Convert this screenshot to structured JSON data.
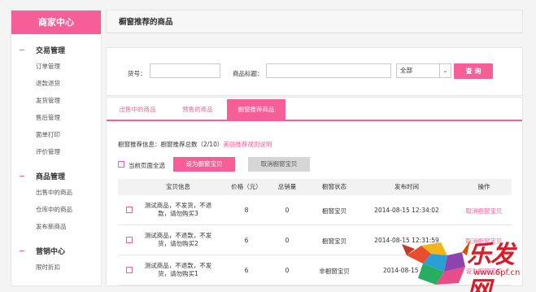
{
  "sidebar": {
    "title": "商家中心",
    "groups": [
      {
        "title": "交易管理",
        "items": [
          "订单管理",
          "退款退货",
          "发货管理",
          "售后管理",
          "面单打印",
          "评价管理"
        ]
      },
      {
        "title": "商品管理",
        "items": [
          "出售中的商品",
          "仓库中的商品",
          "发布新商品"
        ]
      },
      {
        "title": "营销中心",
        "items": [
          "限时折扣"
        ]
      }
    ]
  },
  "header": {
    "title": "橱窗推荐的商品"
  },
  "search": {
    "item_no_label": "货号：",
    "item_no_value": "",
    "title_label": "商品标题：",
    "title_value": "",
    "select_value": "全部",
    "button_label": "查 询"
  },
  "tabs": [
    {
      "label": "出售中的商品",
      "active": false
    },
    {
      "label": "预售的商品",
      "active": false
    },
    {
      "label": "橱窗推荐商品",
      "active": true
    }
  ],
  "info": {
    "text": "橱窗推荐信息：橱窗推荐总数（2/10）",
    "link": "美丽推荐规则说明"
  },
  "bulk": {
    "select_all_label": "当前页面全选",
    "set_button": "设为橱窗宝贝",
    "cancel_button": "取消橱窗宝贝"
  },
  "table": {
    "headers": [
      "宝贝信息",
      "价格（元）",
      "总销量",
      "橱窗状态",
      "发布时间",
      "操作"
    ],
    "rows": [
      {
        "name": "测试商品，不发货，不退款，请勿购买3",
        "price": "8",
        "sales": "0",
        "status": "橱窗宝贝",
        "time": "2014-08-15 12:34:02",
        "action": "取消橱窗宝贝"
      },
      {
        "name": "测试商品，不退款，不发货，请勿购买2",
        "price": "6",
        "sales": "0",
        "status": "橱窗宝贝",
        "time": "2014-08-15 12:31:59",
        "action": "取消橱窗宝贝"
      },
      {
        "name": "测试商品，不退款，不发货，请勿购买1",
        "price": "6",
        "sales": "0",
        "status": "非橱窗宝贝",
        "time": "2014-08-15 12:",
        "action": "设为橱窗宝贝"
      }
    ]
  },
  "watermark": {
    "brand": "乐发网",
    "url": "www.6pf.cn"
  },
  "colors": {
    "accent": "#f55e96",
    "watermark": "#d81b28"
  }
}
